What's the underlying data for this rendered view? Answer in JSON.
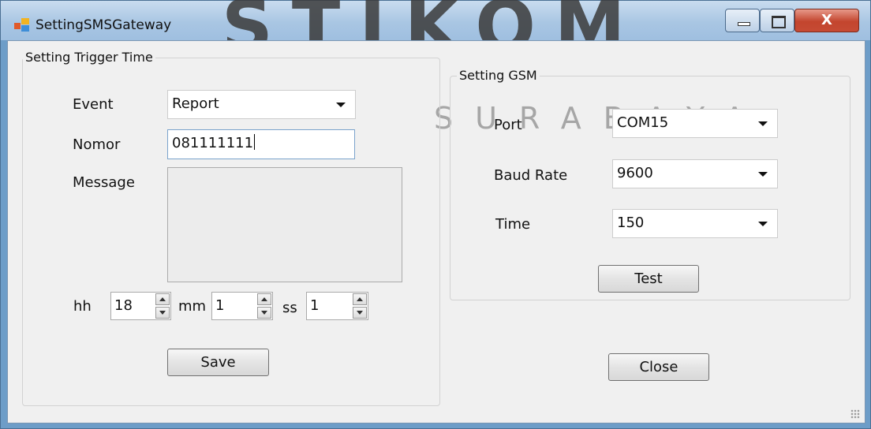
{
  "window": {
    "title": "SettingSMSGateway",
    "watermark_top": "STIKOM",
    "watermark_sub": "SURABAYA",
    "controls": {
      "close_label": "X"
    }
  },
  "trigger_group": {
    "legend": "Setting Trigger Time",
    "event_label": "Event",
    "event_value": "Report",
    "nomor_label": "Nomor",
    "nomor_value": "081111111",
    "message_label": "Message",
    "message_value": "",
    "hh_label": "hh",
    "hh_value": "18",
    "mm_label": "mm",
    "mm_value": "1",
    "ss_label": "ss",
    "ss_value": "1",
    "save_label": "Save"
  },
  "gsm_group": {
    "legend": "Setting GSM",
    "port_label": "Port",
    "port_value": "COM15",
    "baud_label": "Baud Rate",
    "baud_value": "9600",
    "time_label": "Time",
    "time_value": "150",
    "test_label": "Test"
  },
  "footer": {
    "close_label": "Close"
  }
}
